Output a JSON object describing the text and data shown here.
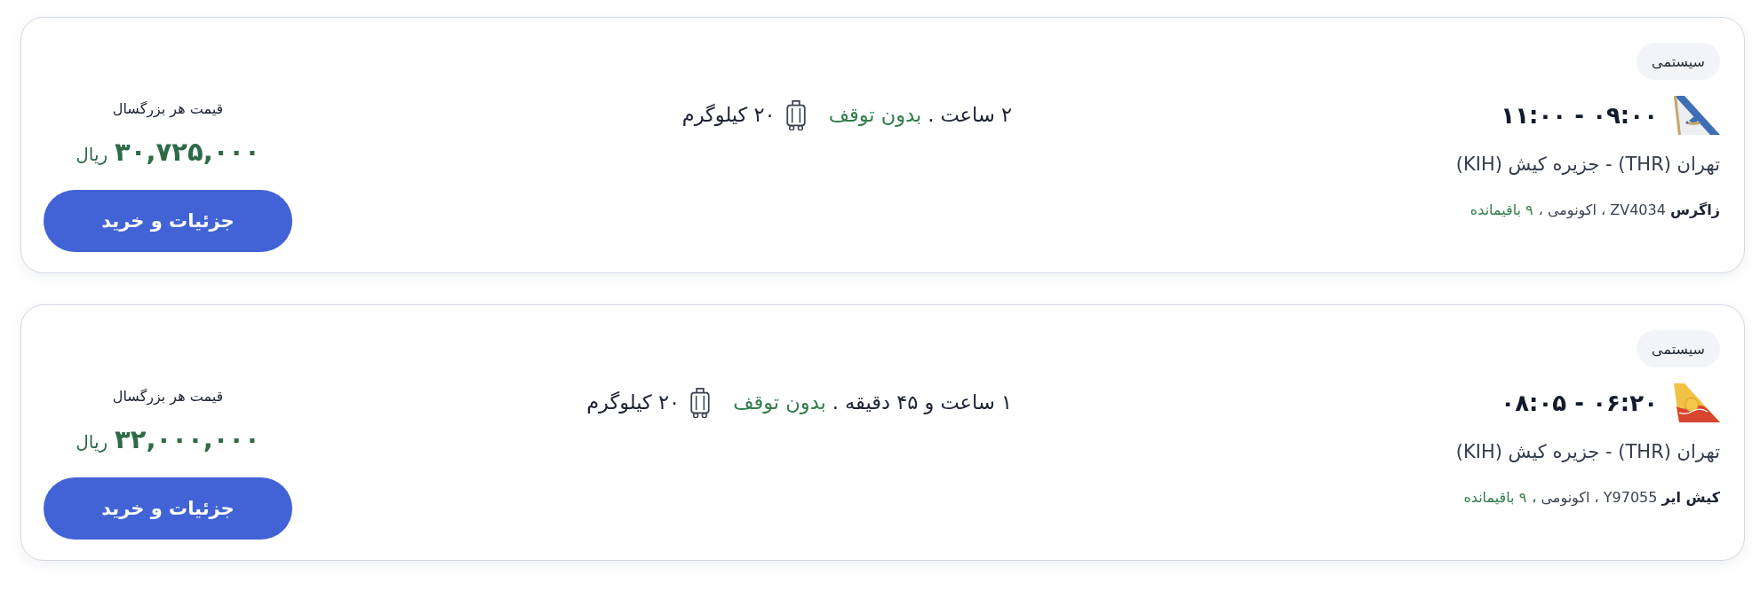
{
  "flights": [
    {
      "badge": "سیستمی",
      "logo": {
        "kind": "bird"
      },
      "times": "۰۹:۰۰ - ۱۱:۰۰",
      "route": "تهران (THR) - جزیره کیش (KIH)",
      "details": "**زاگرس** ZV4034 ، اکونومی ،",
      "seats_left": "۹ باقیمانده",
      "duration": "۲ ساعت .",
      "stops": "بدون توقف",
      "baggage": "۲۰ کیلوگرم",
      "price_label": "قیمت هر بزرگسال",
      "price": "۳۰,۷۲۵,۰۰۰",
      "currency": "ریال",
      "button": "جزئیات و خرید"
    },
    {
      "badge": "سیستمی",
      "logo": {
        "kind": "sun"
      },
      "times": "۰۶:۲۰ - ۰۸:۰۵",
      "route": "تهران (THR) - جزیره کیش (KIH)",
      "details": "**کیش ایر** Y97055 ، اکونومی ،",
      "seats_left": "۹ باقیمانده",
      "duration": "۱ ساعت و ۴۵ دقیقه .",
      "stops": "بدون توقف",
      "baggage": "۲۰ کیلوگرم",
      "price_label": "قیمت هر بزرگسال",
      "price": "۳۲,۰۰۰,۰۰۰",
      "currency": "ریال",
      "button": "جزئیات و خرید"
    }
  ]
}
